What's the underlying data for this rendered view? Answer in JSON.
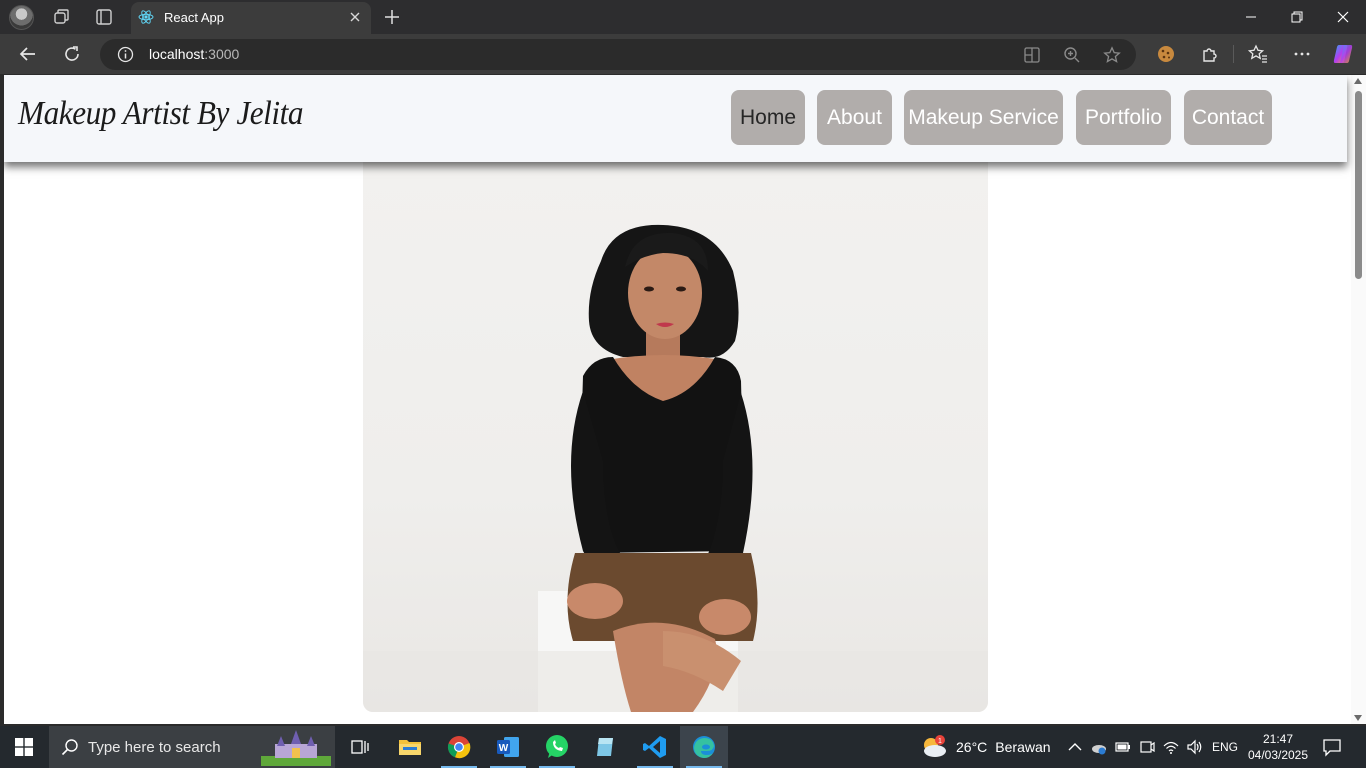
{
  "browser": {
    "tab_title": "React App",
    "url_host": "localhost",
    "url_port": ":3000"
  },
  "site": {
    "brand": "Makeup Artist By Jelita",
    "nav": [
      "Home",
      "About",
      "Makeup Service",
      "Portfolio",
      "Contact"
    ],
    "active_nav": "Home",
    "accent_button_color": "#b1adab",
    "nav_background": "#f5f7fa"
  },
  "hero": {
    "image": "portrait-photo"
  },
  "taskbar": {
    "search_placeholder": "Type here to search",
    "weather_temp": "26°C",
    "weather_desc": "Berawan",
    "weather_badge": "1",
    "language": "ENG",
    "time": "21:47",
    "date": "04/03/2025",
    "apps": [
      "task-view",
      "file-explorer",
      "chrome",
      "word",
      "whatsapp",
      "app-generic",
      "vscode",
      "edge"
    ]
  }
}
